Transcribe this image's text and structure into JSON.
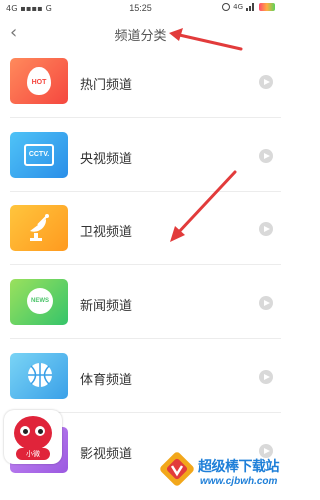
{
  "status_bar": {
    "left_text": "4G ▪▪▪▪ G",
    "time": "15:25",
    "network": "4G"
  },
  "nav": {
    "title": "频道分类",
    "back_icon": "chevron-left-icon"
  },
  "channels": [
    {
      "label": "热门频道",
      "icon": "hot-icon",
      "icon_text": "HOT",
      "color_start": "#ff8a5c",
      "color_end": "#f5473f"
    },
    {
      "label": "央视频道",
      "icon": "tv-icon",
      "icon_text": "CCTV.",
      "color_start": "#4fc3f7",
      "color_end": "#2a8ee8"
    },
    {
      "label": "卫视频道",
      "icon": "satellite-icon",
      "icon_text": "",
      "color_start": "#ffc53d",
      "color_end": "#ff9a1f"
    },
    {
      "label": "新闻频道",
      "icon": "news-icon",
      "icon_text": "NEWS",
      "color_start": "#9be15d",
      "color_end": "#35c46a"
    },
    {
      "label": "体育频道",
      "icon": "basketball-icon",
      "icon_text": "",
      "color_start": "#7ad4f5",
      "color_end": "#3aa0e8"
    },
    {
      "label": "影视频道",
      "icon": "movie-icon",
      "icon_text": "",
      "color_start": "#c58af5",
      "color_end": "#9b59e0"
    }
  ],
  "app_avatar": {
    "badge_text": "小微"
  },
  "watermark": {
    "title": "超级棒下载站",
    "url": "www.cjbwh.com"
  },
  "colors": {
    "annotation_arrow": "#e23b3b",
    "play_button": "#d9d9d9",
    "watermark_blue": "#1e7fd8"
  }
}
